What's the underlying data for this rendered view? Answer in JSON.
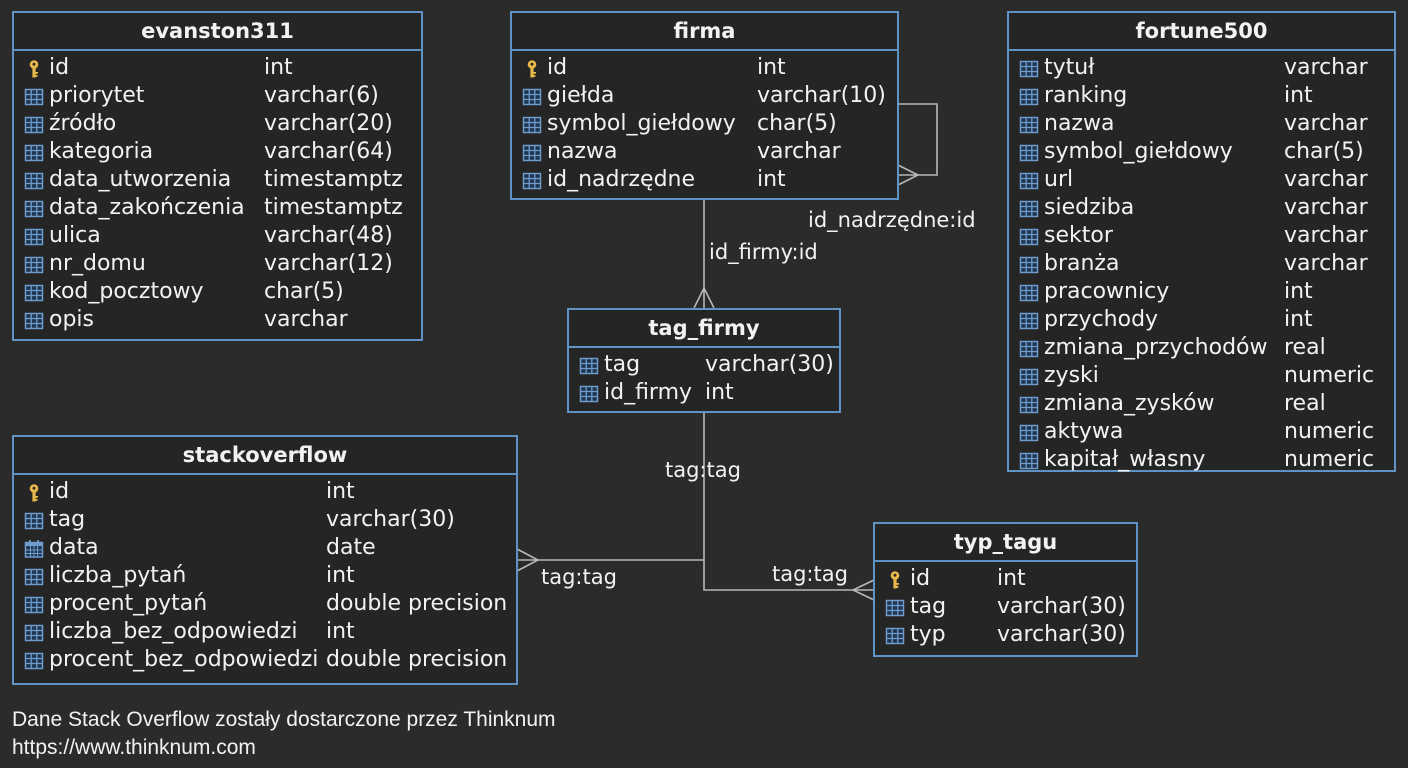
{
  "tables": [
    {
      "key": "evanston311",
      "name": "evanston311",
      "columns": [
        {
          "name": "id",
          "type": "int",
          "icon": "key-icon"
        },
        {
          "name": "priorytet",
          "type": "varchar(6)",
          "icon": "column-icon"
        },
        {
          "name": "źródło",
          "type": "varchar(20)",
          "icon": "column-icon"
        },
        {
          "name": "kategoria",
          "type": "varchar(64)",
          "icon": "column-icon"
        },
        {
          "name": "data_utworzenia",
          "type": "timestamptz",
          "icon": "column-icon"
        },
        {
          "name": "data_zakończenia",
          "type": "timestamptz",
          "icon": "column-icon"
        },
        {
          "name": "ulica",
          "type": "varchar(48)",
          "icon": "column-icon"
        },
        {
          "name": "nr_domu",
          "type": "varchar(12)",
          "icon": "column-icon"
        },
        {
          "name": "kod_pocztowy",
          "type": "char(5)",
          "icon": "column-icon"
        },
        {
          "name": "opis",
          "type": "varchar",
          "icon": "column-icon"
        }
      ]
    },
    {
      "key": "firma",
      "name": "firma",
      "columns": [
        {
          "name": "id",
          "type": "int",
          "icon": "key-icon"
        },
        {
          "name": "giełda",
          "type": "varchar(10)",
          "icon": "column-icon"
        },
        {
          "name": "symbol_giełdowy",
          "type": "char(5)",
          "icon": "column-icon"
        },
        {
          "name": "nazwa",
          "type": "varchar",
          "icon": "column-icon"
        },
        {
          "name": "id_nadrzędne",
          "type": "int",
          "icon": "column-icon"
        }
      ]
    },
    {
      "key": "fortune500",
      "name": "fortune500",
      "columns": [
        {
          "name": "tytuł",
          "type": "varchar",
          "icon": "column-icon"
        },
        {
          "name": "ranking",
          "type": "int",
          "icon": "column-icon"
        },
        {
          "name": "nazwa",
          "type": "varchar",
          "icon": "column-icon"
        },
        {
          "name": "symbol_giełdowy",
          "type": "char(5)",
          "icon": "column-icon"
        },
        {
          "name": "url",
          "type": "varchar",
          "icon": "column-icon"
        },
        {
          "name": "siedziba",
          "type": "varchar",
          "icon": "column-icon"
        },
        {
          "name": "sektor",
          "type": "varchar",
          "icon": "column-icon"
        },
        {
          "name": "branża",
          "type": "varchar",
          "icon": "column-icon"
        },
        {
          "name": "pracownicy",
          "type": "int",
          "icon": "column-icon"
        },
        {
          "name": "przychody",
          "type": "int",
          "icon": "column-icon"
        },
        {
          "name": "zmiana_przychodów",
          "type": "real",
          "icon": "column-icon"
        },
        {
          "name": "zyski",
          "type": "numeric",
          "icon": "column-icon"
        },
        {
          "name": "zmiana_zysków",
          "type": "real",
          "icon": "column-icon"
        },
        {
          "name": "aktywa",
          "type": "numeric",
          "icon": "column-icon"
        },
        {
          "name": "kapitał_własny",
          "type": "numeric",
          "icon": "column-icon"
        }
      ]
    },
    {
      "key": "tag_firmy",
      "name": "tag_firmy",
      "columns": [
        {
          "name": "tag",
          "type": "varchar(30)",
          "icon": "column-icon"
        },
        {
          "name": "id_firmy",
          "type": "int",
          "icon": "column-icon"
        }
      ]
    },
    {
      "key": "stackoverflow",
      "name": "stackoverflow",
      "columns": [
        {
          "name": "id",
          "type": "int",
          "icon": "key-icon"
        },
        {
          "name": "tag",
          "type": "varchar(30)",
          "icon": "column-icon"
        },
        {
          "name": "data",
          "type": "date",
          "icon": "calendar-icon"
        },
        {
          "name": "liczba_pytań",
          "type": "int",
          "icon": "column-icon"
        },
        {
          "name": "procent_pytań",
          "type": "double precision",
          "icon": "column-icon"
        },
        {
          "name": "liczba_bez_odpowiedzi",
          "type": "int",
          "icon": "column-icon"
        },
        {
          "name": "procent_bez_odpowiedzi",
          "type": "double precision",
          "icon": "column-icon"
        }
      ]
    },
    {
      "key": "typ_tagu",
      "name": "typ_tagu",
      "columns": [
        {
          "name": "id",
          "type": "int",
          "icon": "key-icon"
        },
        {
          "name": "tag",
          "type": "varchar(30)",
          "icon": "column-icon"
        },
        {
          "name": "typ",
          "type": "varchar(30)",
          "icon": "column-icon"
        }
      ]
    }
  ],
  "relationships": [
    {
      "key": "firma_self",
      "label": "id_nadrzędne:id"
    },
    {
      "key": "firma_tag_firmy",
      "label": "id_firmy:id"
    },
    {
      "key": "tag_firmy_tag",
      "label": "tag:tag"
    },
    {
      "key": "stackoverflow_tag",
      "label": "tag:tag"
    },
    {
      "key": "typ_tagu_tag",
      "label": "tag:tag"
    }
  ],
  "footer": {
    "line1": "Dane Stack Overflow zostały dostarczone przez Thinknum",
    "line2": "https://www.thinknum.com"
  },
  "colors": {
    "background": "#2b2b2b",
    "border": "#5f93c3",
    "line": "#b8b8b8",
    "key": "#e8b84a",
    "column_icon": "#6f9ccb"
  }
}
